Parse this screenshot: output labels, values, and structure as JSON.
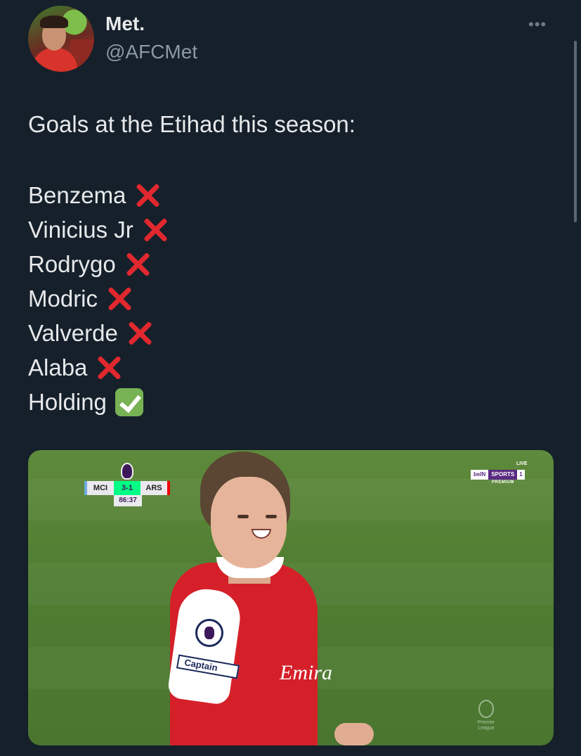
{
  "tweet": {
    "display_name": "Met.",
    "handle": "@AFCMet",
    "more_label": "•••",
    "text_intro": "Goals at the Etihad this season:",
    "players": [
      {
        "name": "Benzema",
        "status": "cross-mark-icon"
      },
      {
        "name": "Vinicius Jr",
        "status": "cross-mark-icon"
      },
      {
        "name": "Rodrygo",
        "status": "cross-mark-icon"
      },
      {
        "name": "Modric",
        "status": "cross-mark-icon"
      },
      {
        "name": "Valverde",
        "status": "cross-mark-icon"
      },
      {
        "name": "Alaba",
        "status": "cross-mark-icon"
      },
      {
        "name": "Holding",
        "status": "check-mark-icon"
      }
    ]
  },
  "media": {
    "scorebug": {
      "home": "MCI",
      "score": "3-1",
      "away": "ARS",
      "clock": "86:37"
    },
    "broadcaster": {
      "brand": "beIN",
      "sports": "SPORTS",
      "channel": "1",
      "live": "LIVE",
      "tier": "PREMIUM"
    },
    "armband_text": "Captain",
    "sponsor_text": "Emira",
    "watermark_text": "Premier League"
  },
  "colors": {
    "background": "#15202b",
    "text_primary": "#e7e9ea",
    "text_secondary": "#8b98a5",
    "cross": "#e0282e",
    "check": "#77b255"
  }
}
